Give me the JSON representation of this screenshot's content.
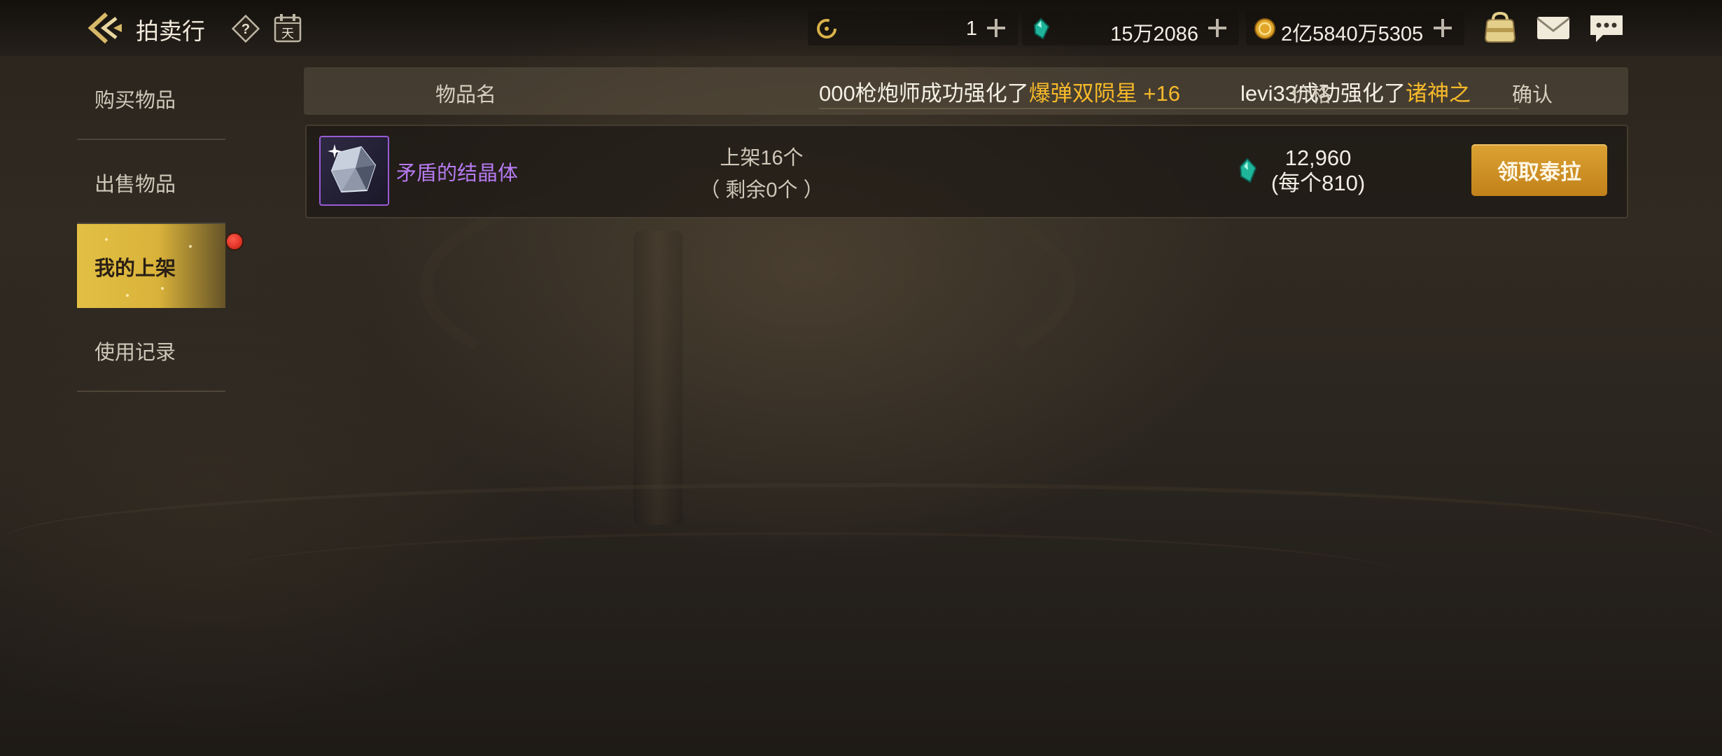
{
  "header": {
    "title": "拍卖行",
    "calendar_glyph": "天"
  },
  "currencies": [
    {
      "name": "c-coin",
      "value": "1"
    },
    {
      "name": "tera-gem",
      "value": "15万2086"
    },
    {
      "name": "gold",
      "value": "2亿5840万5305"
    }
  ],
  "sidebar": {
    "items": [
      {
        "label": "购买物品"
      },
      {
        "label": "出售物品"
      },
      {
        "label": "我的上架"
      },
      {
        "label": "使用记录"
      }
    ]
  },
  "table": {
    "columns": {
      "name": "物品名",
      "price": "价格",
      "confirm": "确认"
    }
  },
  "ticker": {
    "msg1_text": "000枪炮师成功强化了",
    "msg1_item": "爆弹双陨星 +16",
    "msg2_text": "levi33成功强化了",
    "msg2_item": "诸神之"
  },
  "listing": {
    "item_name": "矛盾的结晶体",
    "listed": "上架16个",
    "remaining": "（ 剩余0个 ）",
    "price_total": "12,960",
    "price_each": "(每个810)",
    "button": "领取泰拉"
  },
  "colors": {
    "accent_gold": "#d9b23a",
    "button_orange": "#c98a22",
    "highlight": "#f6b92a",
    "item_rarity_purple": "#b67af0",
    "notification_red": "#e0261a"
  },
  "icons": [
    "back-arrow-icon",
    "help-icon",
    "calendar-icon",
    "c-coin-icon",
    "tera-gem-icon",
    "gold-coin-icon",
    "bag-icon",
    "mail-icon",
    "chat-icon",
    "crystal-item-icon"
  ]
}
